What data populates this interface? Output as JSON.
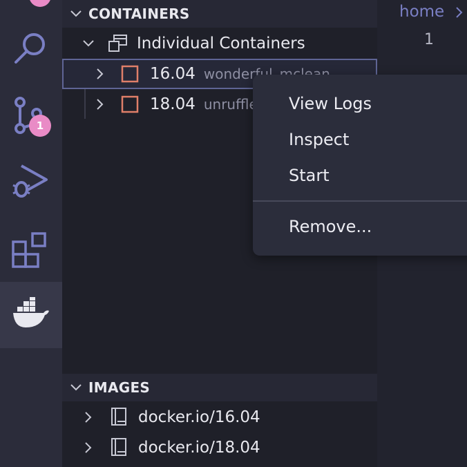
{
  "activity_bar": {
    "items": [
      {
        "icon": "search-icon"
      },
      {
        "icon": "source-control-icon",
        "badge": "1"
      },
      {
        "icon": "run-debug-icon"
      },
      {
        "icon": "extensions-icon"
      },
      {
        "icon": "docker-icon",
        "active": true
      }
    ]
  },
  "containers": {
    "header": "CONTAINERS",
    "group_label": "Individual Containers",
    "items": [
      {
        "label": "16.04",
        "desc": "wonderful_mclean"
      },
      {
        "label": "18.04",
        "desc": "unruffled"
      }
    ]
  },
  "images": {
    "header": "IMAGES",
    "items": [
      {
        "label": "docker.io/16.04"
      },
      {
        "label": "docker.io/18.04"
      }
    ]
  },
  "editor": {
    "breadcrumb": "home",
    "line_number": "1"
  },
  "context_menu": {
    "items": [
      "View Logs",
      "Inspect",
      "Start",
      "Remove..."
    ]
  },
  "colors": {
    "accent": "#7a7fc4",
    "badge": "#e98bc6",
    "stopped_container": "#e07f69"
  }
}
